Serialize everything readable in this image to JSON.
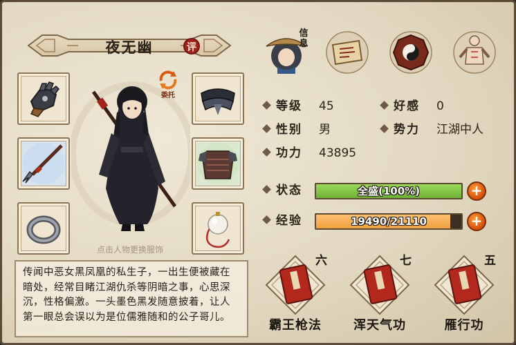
{
  "character": {
    "name": "夜无幽",
    "eval_label": "评",
    "entrust_label": "委托",
    "hint": "点击人物更换服饰",
    "bio": "传闻中恶女黑凤凰的私生子，一出生便被藏在暗处，经常目睹江湖仇杀等阴暗之事，心思深沉，性格偏激。一头墨色黑发随意披着，让人第一眼总会误以为是位儒雅随和的公子哥儿。"
  },
  "tabs": {
    "info_label": "信息"
  },
  "stats": {
    "level_label": "等级",
    "level_value": "45",
    "favor_label": "好感",
    "favor_value": "0",
    "gender_label": "性别",
    "gender_value": "男",
    "faction_label": "势力",
    "faction_value": "江湖中人",
    "power_label": "功力",
    "power_value": "43895"
  },
  "status": {
    "label": "状态",
    "text": "全盛(100%)",
    "fill_fraction": 1.0,
    "color": "#6fb236"
  },
  "exp": {
    "label": "经验",
    "text": "19490/21110",
    "fill_fraction": 0.923,
    "color": "#f0a040"
  },
  "skills": [
    {
      "rank": "六",
      "name": "霸王枪法"
    },
    {
      "rank": "七",
      "name": "浑天气功"
    },
    {
      "rank": "五",
      "name": "雁行功"
    }
  ]
}
